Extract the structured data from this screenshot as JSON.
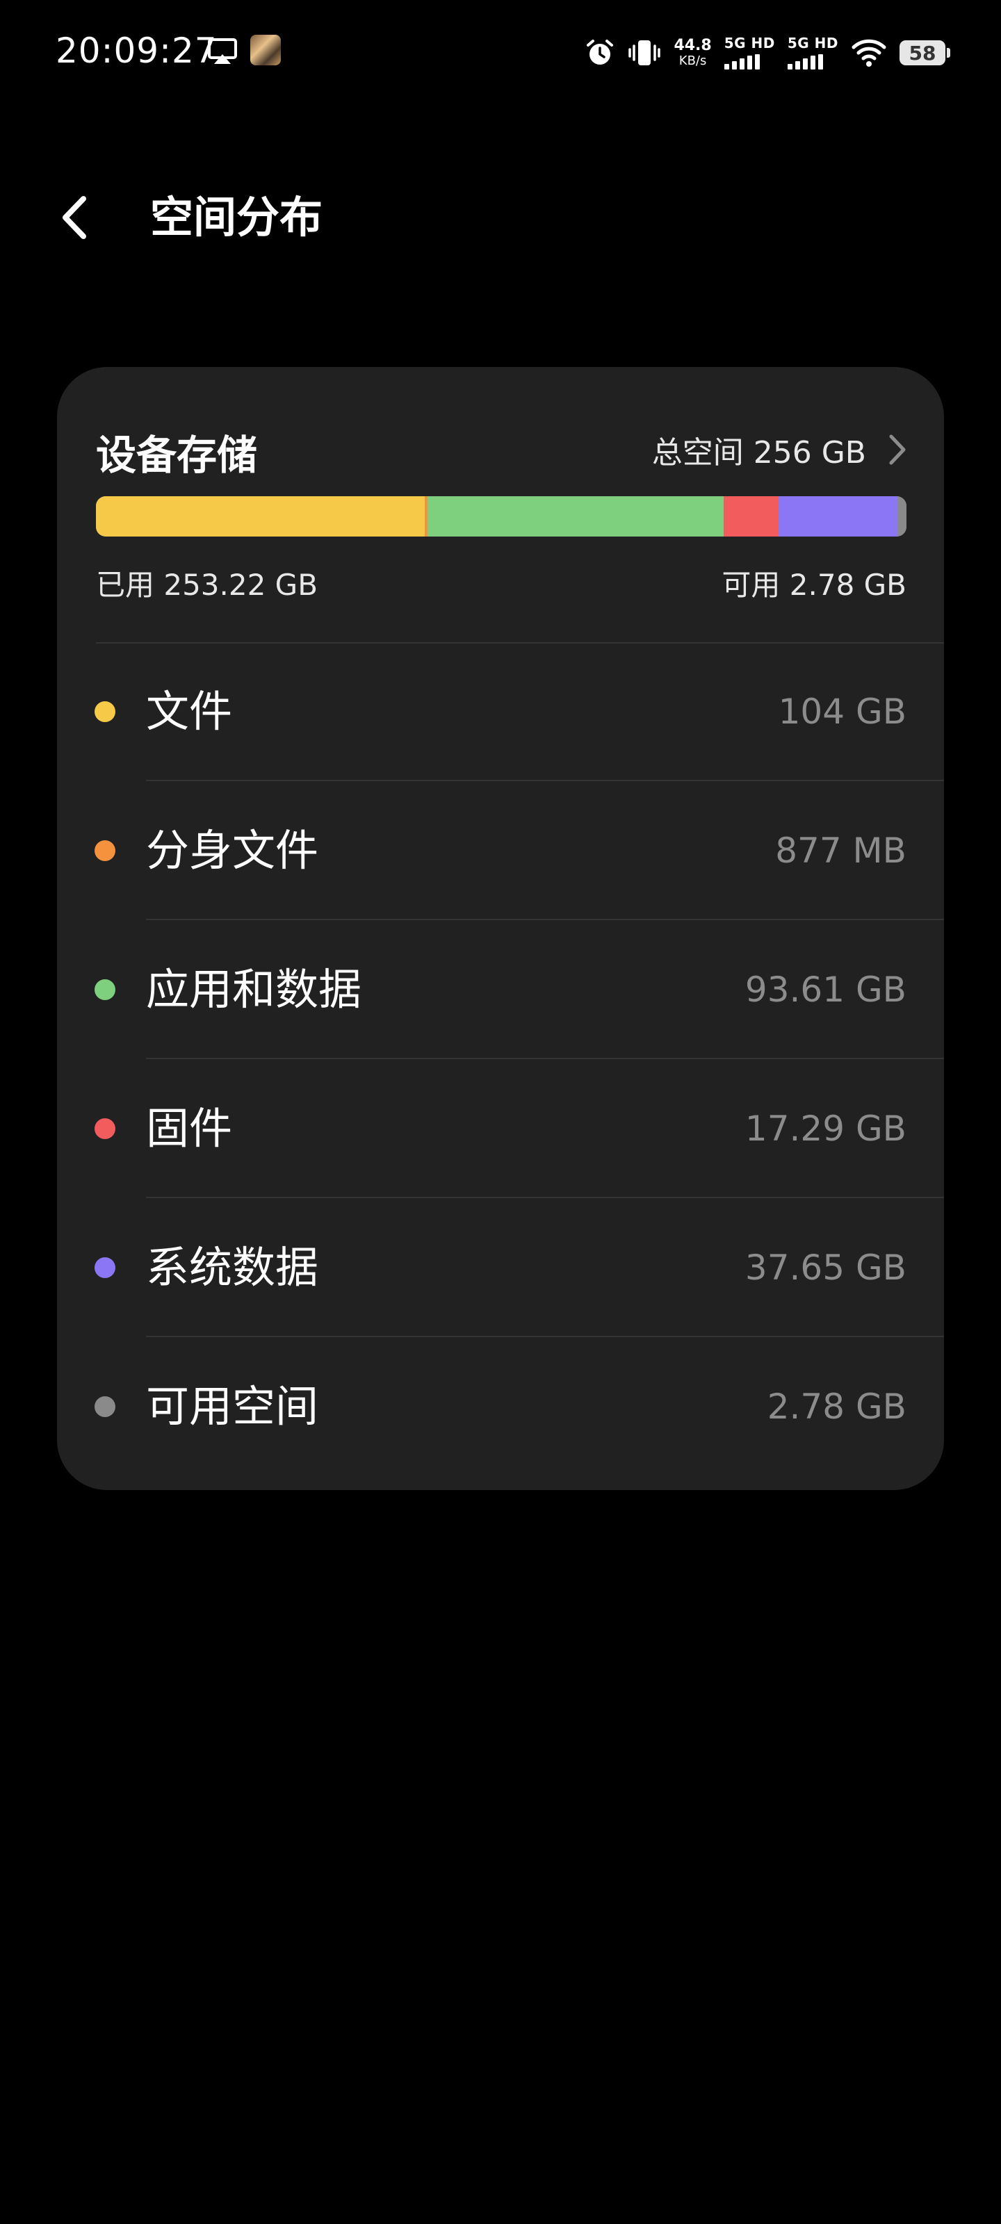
{
  "status_bar": {
    "time": "20:09:27",
    "speed_value": "44.8",
    "speed_unit": "KB/s",
    "sim1_label": "5G HD",
    "sim2_label": "5G HD",
    "battery": "58",
    "icons": [
      "cast-icon",
      "app-notification-icon",
      "alarm-icon",
      "vibrate-icon",
      "signal-icon",
      "wifi-icon",
      "battery-icon"
    ]
  },
  "header": {
    "title": "空间分布",
    "back_icon": "chevron-left-icon"
  },
  "storage": {
    "title": "设备存储",
    "total_label": "总空间 256 GB",
    "used_label": "已用 253.22 GB",
    "available_label": "可用 2.78 GB",
    "chevron_icon": "chevron-right-icon",
    "items": [
      {
        "name": "文件",
        "size": "104 GB",
        "color": "#F7C948",
        "value_gb": 104
      },
      {
        "name": "分身文件",
        "size": "877 MB",
        "color": "#F5923E",
        "value_gb": 0.877
      },
      {
        "name": "应用和数据",
        "size": "93.61 GB",
        "color": "#7ED07F",
        "value_gb": 93.61
      },
      {
        "name": "固件",
        "size": "17.29 GB",
        "color": "#F25C5C",
        "value_gb": 17.29
      },
      {
        "name": "系统数据",
        "size": "37.65 GB",
        "color": "#8B76F5",
        "value_gb": 37.65
      },
      {
        "name": "可用空间",
        "size": "2.78 GB",
        "color": "#8A8A8A",
        "value_gb": 2.78
      }
    ]
  }
}
